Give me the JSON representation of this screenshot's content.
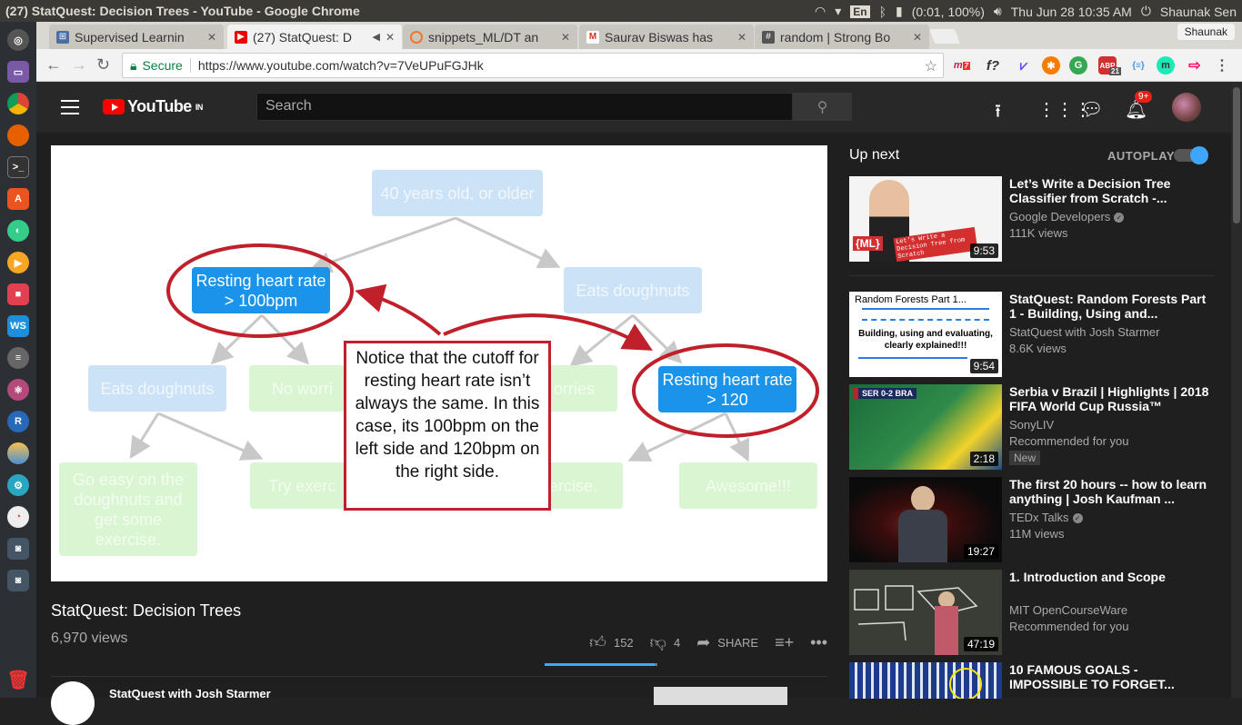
{
  "os": {
    "window_title": "(27) StatQuest: Decision Trees - YouTube - Google Chrome",
    "language": "En",
    "battery": "(0:01, 100%)",
    "clock": "Thu Jun 28 10:35 AM",
    "user": "Shaunak Sen"
  },
  "browser": {
    "tabs": [
      {
        "label": "Supervised Learnin",
        "favicon": "supervised-icon",
        "active": false
      },
      {
        "label": "(27) StatQuest: D",
        "favicon": "youtube-icon",
        "active": true
      },
      {
        "label": "snippets_ML/DT an",
        "favicon": "jupyter-icon",
        "active": false
      },
      {
        "label": "Saurav Biswas has",
        "favicon": "gmail-icon",
        "active": false
      },
      {
        "label": "random | Strong Bo",
        "favicon": "slack-icon",
        "active": false
      }
    ],
    "profile": "Shaunak",
    "secure_label": "Secure",
    "url": "https://www.youtube.com/watch?v=7VeUPuFGJHk",
    "extension_badges": {
      "m7": "7",
      "abp": "21"
    }
  },
  "youtube": {
    "logo_text": "YouTube",
    "logo_region": "IN",
    "search_placeholder": "Search",
    "notification_count": "9+"
  },
  "slide": {
    "root": "40 years old, or older",
    "left_split": "Resting heart rate > 100bpm",
    "right_split": "Eats doughnuts",
    "left_child_a": "Eats doughnuts",
    "left_child_b": "No worri",
    "right_child_a": "orries",
    "right_split_2": "Resting heart rate > 120",
    "leaf_1": "Go easy on the doughnuts and get some exercise.",
    "leaf_2": "Try exerc",
    "leaf_3": "ercise.",
    "leaf_4": "Awesome!!!",
    "callout": "Notice that the cutoff for resting heart rate isn’t always the same. In this case, its 100bpm on the left side and 120bpm on the right side."
  },
  "video": {
    "title": "StatQuest: Decision Trees",
    "views": "6,970 views",
    "likes": "152",
    "dislikes": "4",
    "share_label": "SHARE",
    "like_ratio": 0.974,
    "channel": "StatQuest with Josh Starmer"
  },
  "sidebar": {
    "up_next_label": "Up next",
    "autoplay_label": "AUTOPLAY",
    "autoplay_on": true,
    "items": [
      {
        "title": "Let’s Write a Decision Tree Classifier from Scratch -...",
        "channel": "Google Developers",
        "verified": true,
        "meta": "111K views",
        "duration": "9:53",
        "thumb_text": "{ML} Let's Write a Decision Tree from Scratch"
      },
      {
        "title": "StatQuest: Random Forests Part 1 - Building, Using and...",
        "channel": "StatQuest with Josh Starmer",
        "verified": false,
        "meta": "8.6K views",
        "duration": "9:54",
        "thumb_text": "Random Forests Part 1... Building, using and evaluating, clearly explained!!!"
      },
      {
        "title": "Serbia v Brazil | Highlights | 2018 FIFA World Cup Russia™",
        "channel": "SonyLIV",
        "verified": false,
        "meta": "Recommended for you",
        "badge": "New",
        "duration": "2:18",
        "thumb_text": "SER 0-2 BRA"
      },
      {
        "title": "The first 20 hours -- how to learn anything | Josh Kaufman ...",
        "channel": "TEDx Talks",
        "verified": true,
        "meta": "11M views",
        "duration": "19:27"
      },
      {
        "title": "1. Introduction and Scope",
        "channel": "MIT OpenCourseWare",
        "verified": false,
        "meta": "Recommended for you",
        "duration": "47:19"
      },
      {
        "title": "10 FAMOUS GOALS - IMPOSSIBLE TO FORGET...",
        "channel": "",
        "verified": false,
        "meta": "",
        "duration": ""
      }
    ]
  }
}
